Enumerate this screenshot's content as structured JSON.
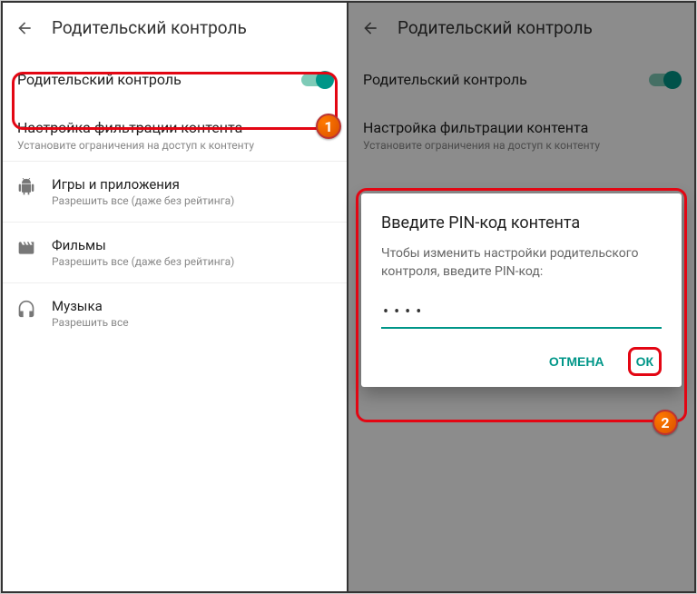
{
  "left": {
    "header_title": "Родительский контроль",
    "toggle_label": "Родительский контроль",
    "section_title": "Настройка фильтрации контента",
    "section_sub": "Установите ограничения на доступ к контенту",
    "items": [
      {
        "title": "Игры и приложения",
        "sub": "Разрешить все (даже без рейтинга)"
      },
      {
        "title": "Фильмы",
        "sub": "Разрешить все (даже без рейтинга)"
      },
      {
        "title": "Музыка",
        "sub": "Разрешить все"
      }
    ],
    "badge": "1"
  },
  "right": {
    "header_title": "Родительский контроль",
    "toggle_label": "Родительский контроль",
    "section_title": "Настройка фильтрации контента",
    "section_sub": "Установите ограничения на доступ к контенту",
    "dialog": {
      "title": "Введите PIN-код контента",
      "body": "Чтобы изменить настройки родительского контроля, введите PIN-код:",
      "pin_display": "••••",
      "cancel": "ОТМЕНА",
      "ok": "ОК"
    },
    "badge": "2"
  }
}
